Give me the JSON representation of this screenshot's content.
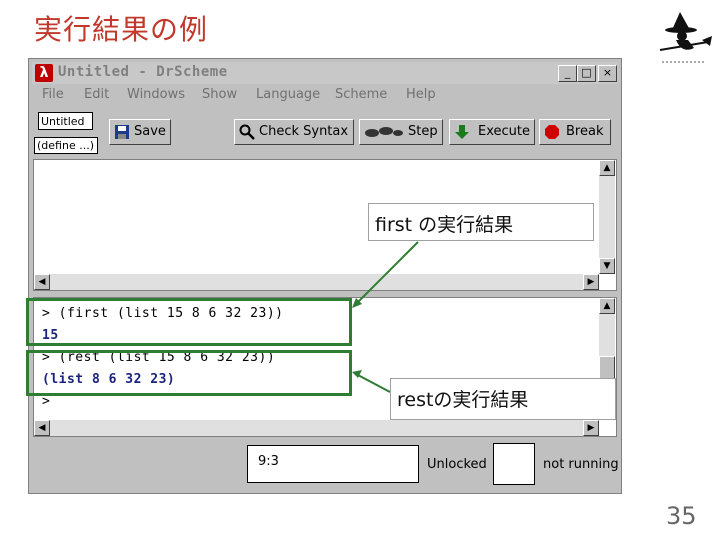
{
  "slide": {
    "title": "実行結果の例",
    "page_number": "35",
    "accent_color": "#c0392b"
  },
  "window": {
    "title": "Untitled - DrScheme",
    "controls": [
      "_",
      "□",
      "×"
    ],
    "menu": [
      "File",
      "Edit",
      "Windows",
      "Show",
      "Language",
      "Scheme",
      "Help"
    ],
    "toolbar": {
      "untitled_label": "Untitled",
      "define_label": "(define ...)",
      "save_label": "Save",
      "check_syntax_label": "Check Syntax",
      "step_label": "Step",
      "execute_label": "Execute",
      "break_label": "Break"
    },
    "interactions": [
      {
        "text": "> (first (list 15 8 6 32 23))",
        "color": "#000000"
      },
      {
        "text": "15",
        "color": "#1a237e"
      },
      {
        "text": "> (rest (list 15 8 6 32 23))",
        "color": "#000000"
      },
      {
        "text": "(list 8 6 32 23)",
        "color": "#1a237e"
      },
      {
        "text": ">",
        "color": "#000000"
      }
    ],
    "status": {
      "position": "9:3",
      "lock_state": "Unlocked",
      "run_state": "not running"
    }
  },
  "callouts": {
    "first": "first の実行結果",
    "rest": "restの実行結果",
    "color": "#2e7d32"
  }
}
